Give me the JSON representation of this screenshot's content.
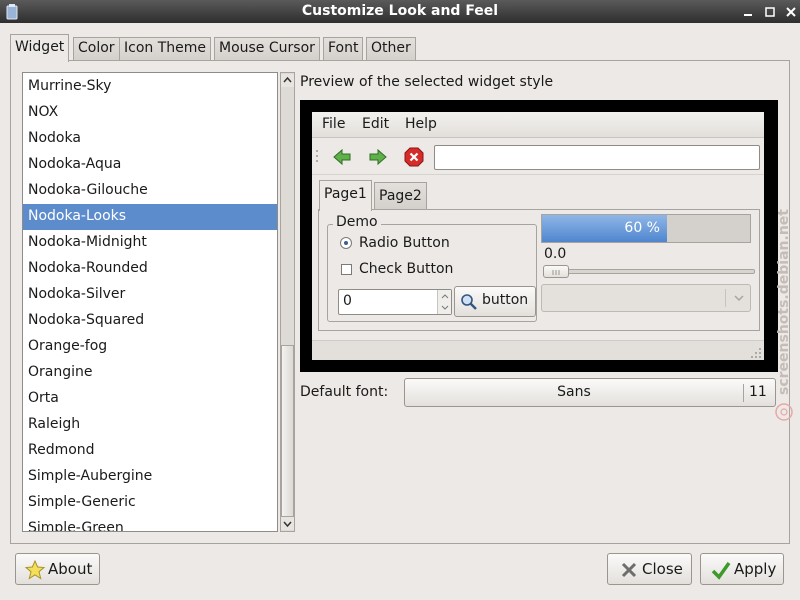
{
  "window": {
    "title": "Customize Look and Feel"
  },
  "tabs": [
    {
      "label": "Widget",
      "active": true
    },
    {
      "label": "Color"
    },
    {
      "label": "Icon Theme"
    },
    {
      "label": "Mouse Cursor"
    },
    {
      "label": "Font"
    },
    {
      "label": "Other"
    }
  ],
  "theme_list": {
    "items": [
      "Murrine-Sky",
      "NOX",
      "Nodoka",
      "Nodoka-Aqua",
      "Nodoka-Gilouche",
      "Nodoka-Looks",
      "Nodoka-Midnight",
      "Nodoka-Rounded",
      "Nodoka-Silver",
      "Nodoka-Squared",
      "Orange-fog",
      "Orangine",
      "Orta",
      "Raleigh",
      "Redmond",
      "Simple-Aubergine",
      "Simple-Generic",
      "Simple-Green"
    ],
    "selected": "Nodoka-Looks"
  },
  "preview": {
    "label": "Preview of the selected widget style",
    "menu": [
      "File",
      "Edit",
      "Help"
    ],
    "toolbar_icons": [
      "back-arrow-icon",
      "forward-arrow-icon",
      "stop-icon"
    ],
    "tabs": [
      "Page1",
      "Page2"
    ],
    "frame_label": "Demo",
    "radio_label": "Radio Button",
    "check_label": "Check Button",
    "spin_value": "0",
    "button_label": "button",
    "progress_fraction": 0.6,
    "progress_text": "60 %",
    "scale_value": "0.0"
  },
  "font": {
    "label": "Default font:",
    "name": "Sans",
    "size": "11"
  },
  "buttons": {
    "about": "About",
    "close": "Close",
    "apply": "Apply"
  },
  "watermark": "screenshots.debian.net",
  "colors": {
    "selection": "#5c8ccc",
    "progress": "#4f86cf",
    "titlebar": "#3a3a3a"
  }
}
